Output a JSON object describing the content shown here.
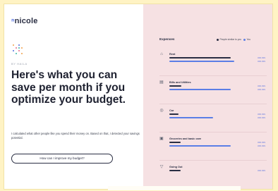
{
  "brand": {
    "logo": "nicole"
  },
  "hero": {
    "byline": "BY HAILA",
    "headline": "Here's what you can save per month if you optimize your budget.",
    "paragraph": "I calculated what other people like you spend their money on. Based on that, I detected your savings potential.",
    "cta": "How can I improve my budget?"
  },
  "expenses": {
    "title": "Expenses",
    "legend": {
      "people": "People similar to you",
      "you": "You"
    },
    "colors": {
      "people": "#2a2e43",
      "you": "#5b7ee6"
    },
    "categories": [
      {
        "name": "Rent",
        "icon": "home-icon",
        "people_value": "¥¥¥ ¥¥¥",
        "you_value": "¥¥¥ ¥¥¥",
        "people_fraction": 0.78,
        "you_fraction": 0.82,
        "desc": ""
      },
      {
        "name": "Bills and Utilities",
        "icon": "receipt-icon",
        "people_value": "¥¥¥ ¥¥¥",
        "you_value": "¥¥¥ ¥¥¥",
        "people_fraction": 0.15,
        "you_fraction": 0.78,
        "desc": ""
      },
      {
        "name": "Car",
        "icon": "car-icon",
        "people_value": "¥¥¥ ¥¥¥",
        "you_value": "¥¥¥ ¥¥¥",
        "people_fraction": 0.12,
        "you_fraction": 0.55,
        "desc": ""
      },
      {
        "name": "Groceries and basic care",
        "icon": "cart-icon",
        "people_value": "¥¥¥ ¥¥¥",
        "you_value": "¥¥¥ ¥¥¥",
        "people_fraction": 0.14,
        "you_fraction": 0.78,
        "desc": ""
      },
      {
        "name": "Going Out",
        "icon": "glass-icon",
        "people_value": "¥¥¥ ¥¥¥",
        "you_value": "",
        "people_fraction": 0.14,
        "you_fraction": 0,
        "desc": ""
      }
    ]
  }
}
